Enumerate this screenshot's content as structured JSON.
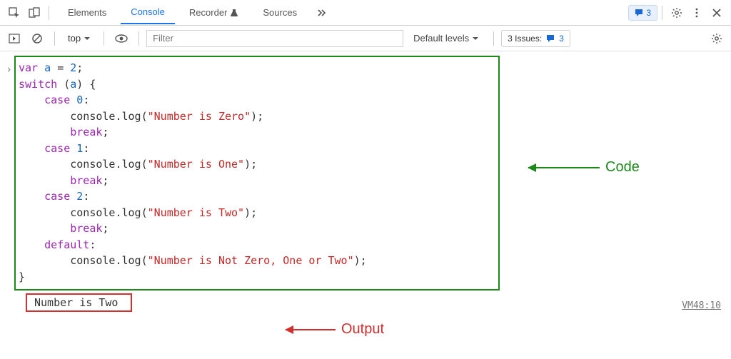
{
  "topbar": {
    "tabs": {
      "elements": "Elements",
      "console": "Console",
      "recorder": "Recorder",
      "sources": "Sources"
    },
    "messages_badge": "3"
  },
  "subbar": {
    "context": "top",
    "filter_placeholder": "Filter",
    "levels_label": "Default levels",
    "issues_label": "3 Issues:",
    "issues_count": "3"
  },
  "code": {
    "tokens": {
      "var": "var",
      "a": "a",
      "eq": "=",
      "two": "2",
      "switch": "switch",
      "case": "case",
      "zero": "0",
      "one": "1",
      "twocase": "2",
      "default": "default",
      "break": "break",
      "consolelog": "console.log",
      "s_zero": "\"Number is Zero\"",
      "s_one": "\"Number is One\"",
      "s_two": "\"Number is Two\"",
      "s_def": "\"Number is Not Zero, One or Two\""
    }
  },
  "output": {
    "text": "Number is Two",
    "source": "VM48:10"
  },
  "annotations": {
    "code": "Code",
    "output": "Output"
  }
}
